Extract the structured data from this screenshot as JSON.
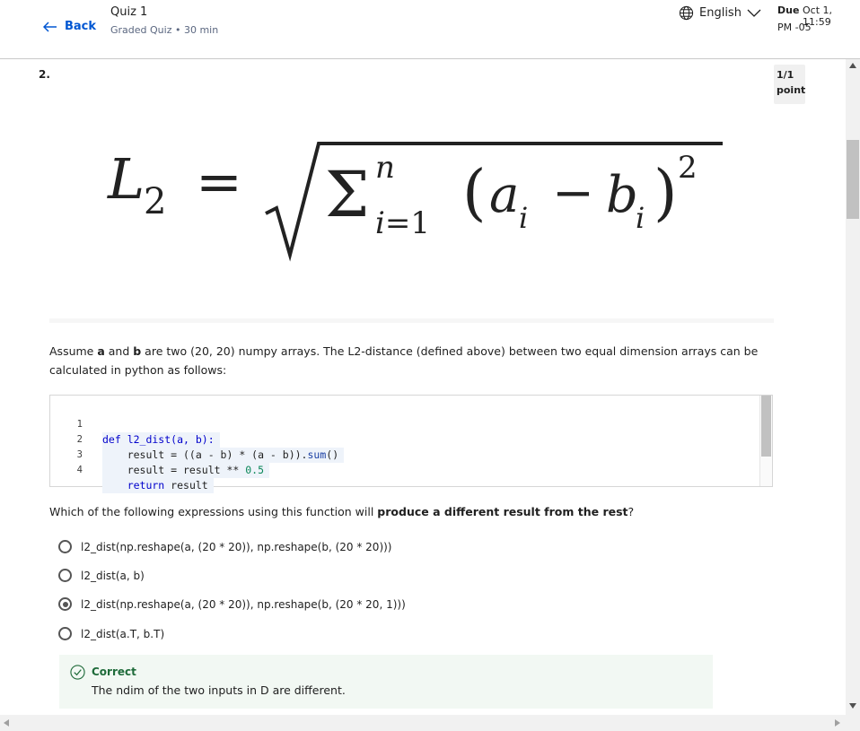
{
  "header": {
    "back_label": "Back",
    "quiz_title": "Quiz 1",
    "quiz_subtitle": "Graded Quiz • 30 min",
    "language": "English",
    "due_label": "Due",
    "due_value_line1": "Oct 1, 11:59",
    "due_value_line2": "PM -05"
  },
  "question": {
    "number": "2.",
    "points_line1": "1/1",
    "points_line2": "point",
    "prompt_part1": "Assume ",
    "prompt_a": "a",
    "prompt_and": " and ",
    "prompt_b": "b",
    "prompt_part2": " are two (20, 20) numpy arrays. The L2-distance (defined above) between two equal dimension arrays can be calculated in python as follows:",
    "code": {
      "line_numbers": [
        "1",
        "2",
        "3",
        "4"
      ],
      "line1": "def l2_dist(a, b):",
      "line2_a": "    result = ((a - b) * (a - b)).",
      "line2_fn": "sum",
      "line2_b": "()",
      "line3_a": "    result = result ** ",
      "line3_num": "0.5",
      "line4_kw": "    return",
      "line4_b": " result"
    },
    "which_part1": "Which of the following expressions using this function will ",
    "which_bold": "produce a different result from the rest",
    "which_part2": "?",
    "options": [
      {
        "label": "l2_dist(np.reshape(a, (20 * 20)), np.reshape(b, (20 * 20)))",
        "selected": false
      },
      {
        "label": "l2_dist(a, b)",
        "selected": false
      },
      {
        "label": "l2_dist(np.reshape(a, (20 * 20)), np.reshape(b, (20 * 20, 1)))",
        "selected": true
      },
      {
        "label": "l2_dist(a.T, b.T)",
        "selected": false
      }
    ],
    "feedback": {
      "title": "Correct",
      "text": "The ndim of the two inputs in D are different."
    }
  },
  "colors": {
    "link": "#0056d2",
    "correct": "#1f6b3a",
    "feedback_bg": "#f2f8f3"
  }
}
